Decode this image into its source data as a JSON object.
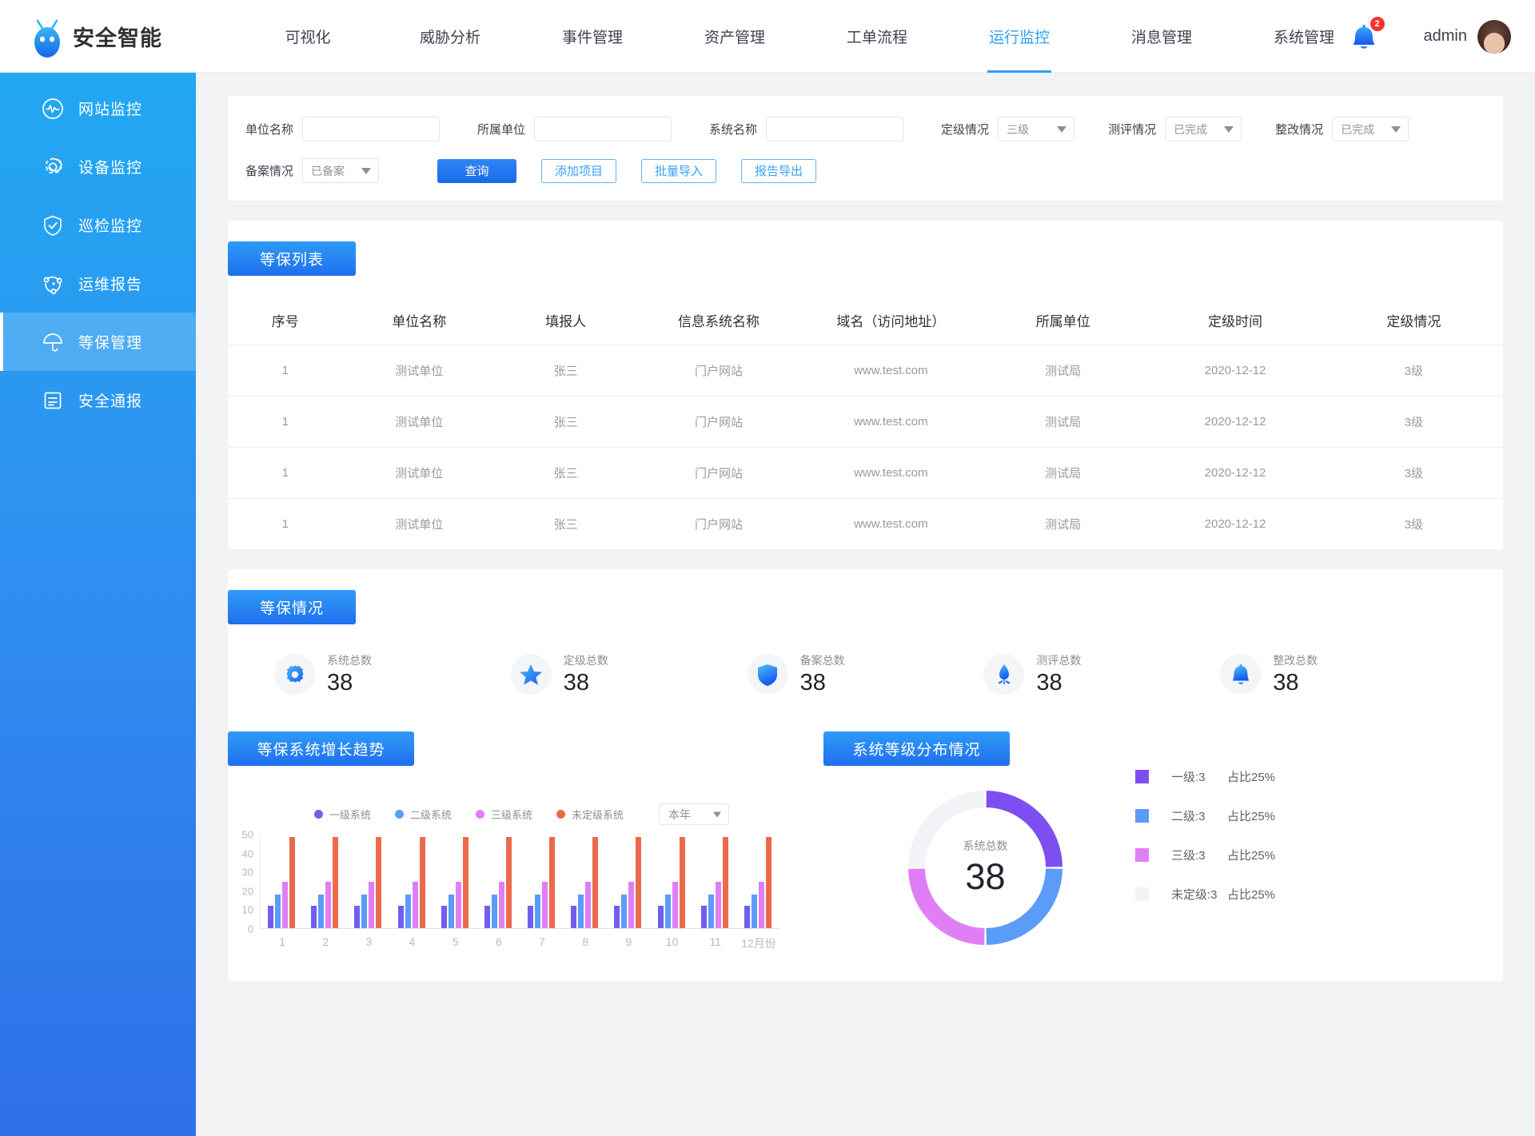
{
  "header": {
    "brand": "安全智能",
    "nav": [
      {
        "label": "可视化",
        "active": false
      },
      {
        "label": "威胁分析",
        "active": false
      },
      {
        "label": "事件管理",
        "active": false
      },
      {
        "label": "资产管理",
        "active": false
      },
      {
        "label": "工单流程",
        "active": false
      },
      {
        "label": "运行监控",
        "active": true
      },
      {
        "label": "消息管理",
        "active": false
      },
      {
        "label": "系统管理",
        "active": false
      }
    ],
    "notification_count": "2",
    "username": "admin"
  },
  "sidebar": {
    "items": [
      {
        "label": "网站监控",
        "icon": "pulse-icon",
        "active": false
      },
      {
        "label": "设备监控",
        "icon": "gear-icon",
        "active": false
      },
      {
        "label": "巡检监控",
        "icon": "shield-check-icon",
        "active": false
      },
      {
        "label": "运维报告",
        "icon": "network-icon",
        "active": false
      },
      {
        "label": "等保管理",
        "icon": "umbrella-icon",
        "active": true
      },
      {
        "label": "安全通报",
        "icon": "document-icon",
        "active": false
      }
    ]
  },
  "filters": {
    "unit_name": {
      "label": "单位名称",
      "value": "",
      "placeholder": ""
    },
    "belong_unit": {
      "label": "所属单位",
      "value": "",
      "placeholder": ""
    },
    "system_name": {
      "label": "系统名称",
      "value": "",
      "placeholder": ""
    },
    "grade_status": {
      "label": "定级情况",
      "value": "三级"
    },
    "eval_status": {
      "label": "测评情况",
      "value": "已完成"
    },
    "rectify_status": {
      "label": "整改情况",
      "value": "已完成"
    },
    "record_status": {
      "label": "备案情况",
      "value": "已备案"
    },
    "buttons": {
      "query": "查询",
      "add_item": "添加项目",
      "batch_import": "批量导入",
      "report_export": "报告导出"
    }
  },
  "list_section": {
    "title": "等保列表",
    "columns": [
      "序号",
      "单位名称",
      "填报人",
      "信息系统名称",
      "域名（访问地址）",
      "所属单位",
      "定级时间",
      "定级情况"
    ],
    "rows": [
      [
        "1",
        "测试单位",
        "张三",
        "门户网站",
        "www.test.com",
        "测试局",
        "2020-12-12",
        "3级"
      ],
      [
        "1",
        "测试单位",
        "张三",
        "门户网站",
        "www.test.com",
        "测试局",
        "2020-12-12",
        "3级"
      ],
      [
        "1",
        "测试单位",
        "张三",
        "门户网站",
        "www.test.com",
        "测试局",
        "2020-12-12",
        "3级"
      ],
      [
        "1",
        "测试单位",
        "张三",
        "门户网站",
        "www.test.com",
        "测试局",
        "2020-12-12",
        "3级"
      ]
    ]
  },
  "stats_section": {
    "title": "等保情况",
    "stats": [
      {
        "label": "系统总数",
        "value": "38",
        "icon": "gear-icon"
      },
      {
        "label": "定级总数",
        "value": "38",
        "icon": "star-icon"
      },
      {
        "label": "备案总数",
        "value": "38",
        "icon": "shield-icon"
      },
      {
        "label": "测评总数",
        "value": "38",
        "icon": "flower-icon"
      },
      {
        "label": "整改总数",
        "value": "38",
        "icon": "bell-icon"
      }
    ]
  },
  "growth_chart": {
    "title": "等保系统增长趋势",
    "year_select": "本年"
  },
  "distribution_chart": {
    "title": "系统等级分布情况",
    "center_label": "系统总数",
    "center_value": "38"
  },
  "chart_data": [
    {
      "type": "bar",
      "title": "等保系统增长趋势",
      "xlabel": "",
      "ylabel": "",
      "ylim": [
        0,
        50
      ],
      "yticks": [
        0,
        10,
        20,
        30,
        40,
        50
      ],
      "grid": false,
      "legend_position": "top",
      "categories": [
        "1",
        "2",
        "3",
        "4",
        "5",
        "6",
        "7",
        "8",
        "9",
        "10",
        "11",
        "12月份"
      ],
      "series": [
        {
          "name": "一级系统",
          "color": "#6f5ef0",
          "values": [
            12,
            12,
            12,
            12,
            12,
            12,
            12,
            12,
            12,
            12,
            12,
            12
          ]
        },
        {
          "name": "二级系统",
          "color": "#5b9cf8",
          "values": [
            18,
            18,
            18,
            18,
            18,
            18,
            18,
            18,
            18,
            18,
            18,
            18
          ]
        },
        {
          "name": "三级系统",
          "color": "#e07ff5",
          "values": [
            24.5,
            24.5,
            24.5,
            24.5,
            24.5,
            24.5,
            24.5,
            24.5,
            24.5,
            24.5,
            24.5,
            24.5
          ]
        },
        {
          "name": "未定级系统",
          "color": "#ec6a4c",
          "values": [
            48.5,
            48.5,
            48.5,
            48.5,
            48.5,
            48.5,
            48.5,
            48.5,
            48.5,
            48.5,
            48.5,
            48.5
          ]
        }
      ]
    },
    {
      "type": "pie",
      "title": "系统等级分布情况",
      "center_label": "系统总数",
      "center_value": 38,
      "legend_position": "right",
      "slices": [
        {
          "name": "一级",
          "count": 3,
          "percent": 25,
          "label": "一级:3",
          "pct_label": "占比25%",
          "color": "#7d4ff0"
        },
        {
          "name": "二级",
          "count": 3,
          "percent": 25,
          "label": "二级:3",
          "pct_label": "占比25%",
          "color": "#5b9cf8"
        },
        {
          "name": "三级",
          "count": 3,
          "percent": 25,
          "label": "三级:3",
          "pct_label": "占比25%",
          "color": "#e07ff5"
        },
        {
          "name": "未定级",
          "count": 3,
          "percent": 25,
          "label": "未定级:3",
          "pct_label": "占比25%",
          "color": "#f2f3f6"
        }
      ]
    }
  ]
}
